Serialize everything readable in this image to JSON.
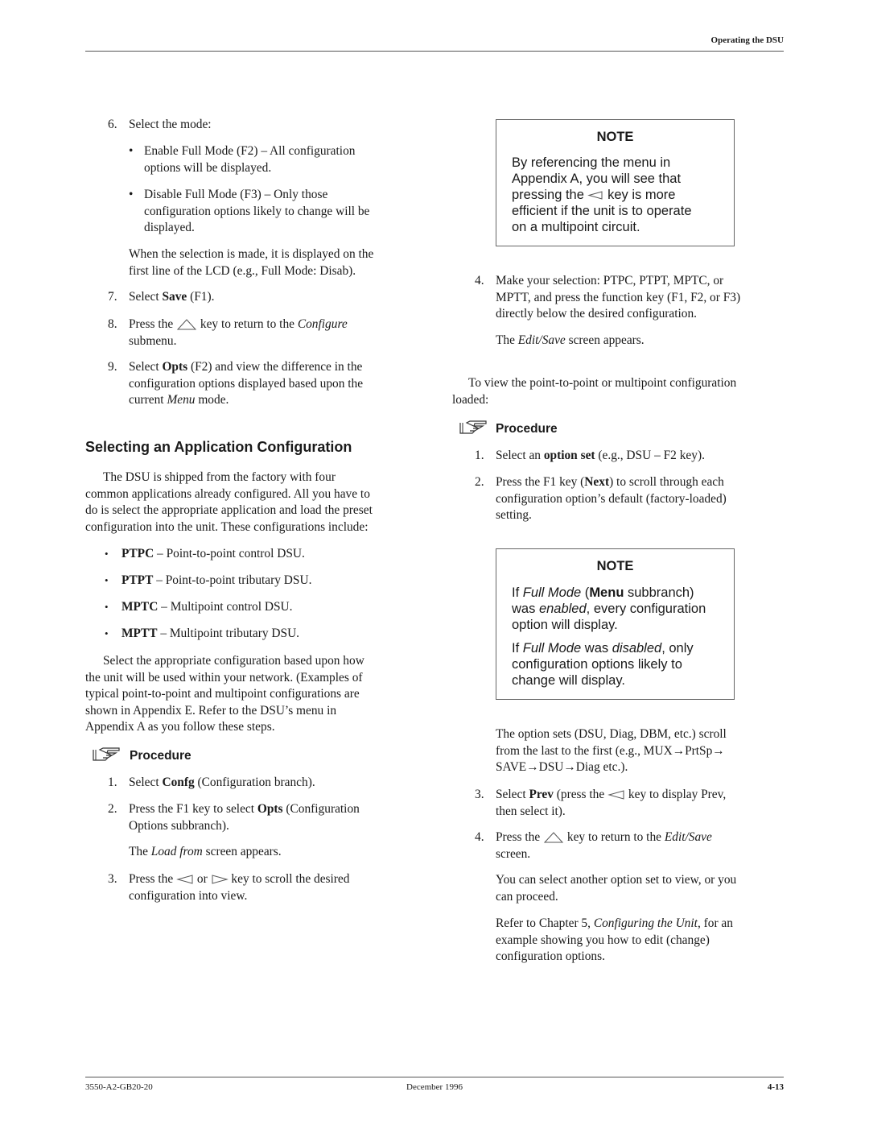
{
  "header": {
    "title": "Operating the DSU"
  },
  "footer": {
    "doc_number": "3550-A2-GB20-20",
    "date": "December 1996",
    "page": "4-13"
  },
  "left": {
    "step6": {
      "num": "6.",
      "text": "Select the mode:"
    },
    "mode_options": [
      {
        "line1": "Enable Full Mode (F2) – All configuration",
        "line2": "options will be displayed."
      },
      {
        "line1": "Disable Full Mode (F3) – Only those",
        "line2": "configuration options likely to change will be",
        "line3": "displayed."
      }
    ],
    "selection_note": {
      "line1": "When the selection is made, it is displayed on the",
      "line2": "first line of the LCD (e.g., Full Mode: Disab)."
    },
    "step7": {
      "num": "7.",
      "pre": "Select ",
      "bold": "Save",
      "post": " (F1)."
    },
    "step8": {
      "num": "8.",
      "pre": "Press the",
      "key": "up-triangle-key",
      "mid": "key to return to the ",
      "italic": "Configure",
      "line2": "submenu."
    },
    "step9": {
      "num": "9.",
      "pre": "Select ",
      "bold": "Opts",
      "post": " (F2) and view the difference in the",
      "line2": "configuration options displayed based upon the",
      "line3_pre": "current ",
      "line3_italic": "Menu",
      "line3_post": " mode."
    },
    "section_heading": "Selecting an Application Configuration",
    "intro": {
      "line1": "The DSU is shipped from the factory with four",
      "line2": "common applications already configured. All you have to",
      "line3": "do is select the appropriate application and load the preset",
      "line4": "configuration into the unit. These configurations include:"
    },
    "configs": [
      {
        "code": "PTPC",
        "desc": " – Point-to-point control DSU."
      },
      {
        "code": "PTPT",
        "desc": " – Point-to-point tributary DSU."
      },
      {
        "code": "MPTC",
        "desc": " – Multipoint control DSU."
      },
      {
        "code": "MPTT",
        "desc": " – Multipoint tributary DSU."
      }
    ],
    "select_para": {
      "line1": "Select the appropriate configuration based upon how",
      "line2": "the unit will be used within your network. (Examples of",
      "line3": "typical point-to-point and multipoint configurations are",
      "line4": "shown in Appendix E. Refer to the DSU’s menu in",
      "line5": "Appendix A as you follow these steps."
    },
    "procedure": {
      "title": "Procedure",
      "icon": "pointing-hand-icon",
      "step1": {
        "num": "1.",
        "pre": "Select ",
        "bold": "Confg",
        "post": " (Configuration branch)."
      },
      "step2": {
        "num": "2.",
        "pre": "Press the F1 key to select ",
        "bold": "Opts",
        "post": " (Configuration",
        "line2": "Options subbranch)."
      },
      "load_from": {
        "pre": "The ",
        "italic": "Load from",
        "post": " screen appears."
      },
      "step3": {
        "num": "3.",
        "pre": "Press the",
        "key1": "left-triangle-key",
        "mid": "or",
        "key2": "right-triangle-key",
        "post": "key to scroll the desired",
        "line2": "configuration into view."
      }
    }
  },
  "right": {
    "note1": {
      "title": "NOTE",
      "line1": "By referencing the menu in",
      "line2": "Appendix A, you will see that",
      "line3_pre": "pressing the",
      "line3_key": "left-triangle-key",
      "line3_post": "key is more",
      "line4": "efficient if the unit is to operate",
      "line5": "on a multipoint circuit."
    },
    "step4": {
      "num": "4.",
      "line1": "Make your selection: PTPC, PTPT, MPTC, or",
      "line2": "MPTT, and press the function key (F1, F2, or F3)",
      "line3": "directly below the desired configuration."
    },
    "edit_save": {
      "pre": "The ",
      "italic": "Edit/Save",
      "post": " screen appears."
    },
    "view_para": {
      "line1": "To view the point-to-point or multipoint configuration",
      "line2": "loaded:"
    },
    "procedure": {
      "title": "Procedure",
      "icon": "pointing-hand-icon",
      "step1": {
        "num": "1.",
        "pre": "Select an ",
        "bold": "option set",
        "post": " (e.g., DSU – F2 key)."
      },
      "step2": {
        "num": "2.",
        "pre": "Press the F1 key (",
        "bold": "Next",
        "post": ") to scroll through each",
        "line2": "configuration option’s default (factory-loaded)",
        "line3": "setting."
      }
    },
    "note2": {
      "title": "NOTE",
      "p1_l1_a": "If ",
      "p1_l1_i": "Full Mode",
      "p1_l1_b": " (",
      "p1_l1_bold": "Menu",
      "p1_l1_c": " subbranch)",
      "p1_l2_a": "was ",
      "p1_l2_i": "enabled",
      "p1_l2_b": ", every configuration",
      "p1_l3": "option will display.",
      "p2_l1_a": "If ",
      "p2_l1_i": "Full Mode",
      "p2_l1_b": " was ",
      "p2_l1_i2": "disabled",
      "p2_l1_c": ", only",
      "p2_l2": "configuration options likely to",
      "p2_l3": "change will display."
    },
    "option_sets": {
      "line1": "The option sets (DSU, Diag, DBM, etc.) scroll",
      "line2": "from the last to the first (e.g., MUX→PrtSp→",
      "line3": "SAVE→DSU→Diag etc.)."
    },
    "step3": {
      "num": "3.",
      "pre": "Select ",
      "bold": "Prev",
      "post1": " (press the",
      "key": "left-triangle-key",
      "post2": "key to display Prev,",
      "line2": "then select it)."
    },
    "step4b": {
      "num": "4.",
      "pre": "Press the",
      "key": "up-triangle-key",
      "mid": "key to return to the ",
      "italic": "Edit/Save",
      "line2": "screen."
    },
    "proceed": {
      "line1": "You can select another option set to view, or you",
      "line2": "can proceed."
    },
    "refer": {
      "pre": "Refer to Chapter 5, ",
      "italic": "Configuring the Unit",
      "post": ", for an",
      "line2": "example showing you how to edit (change)",
      "line3": "configuration options."
    }
  }
}
